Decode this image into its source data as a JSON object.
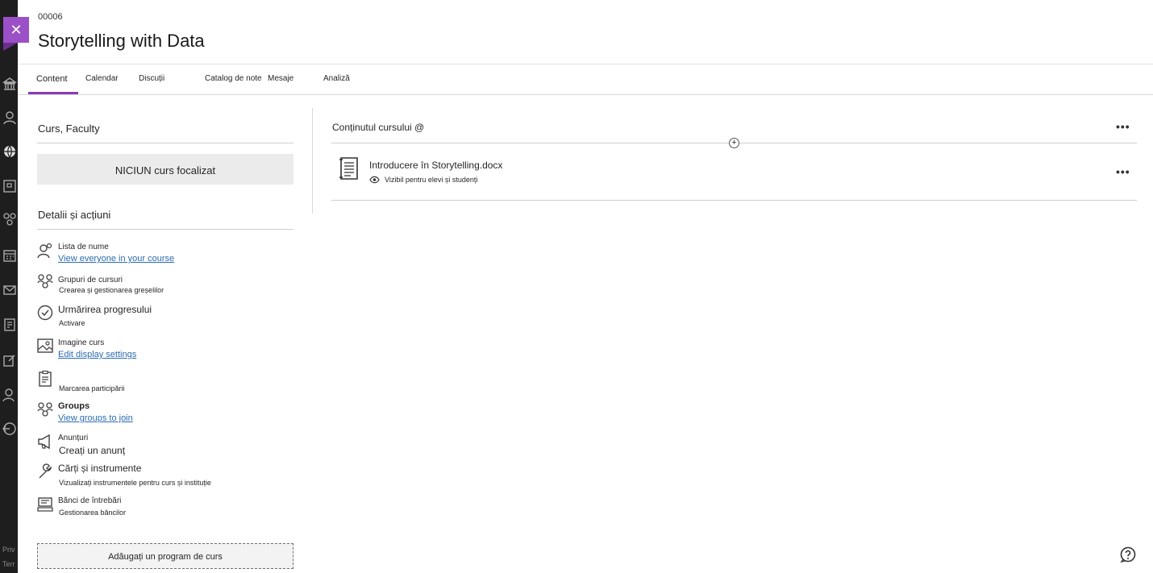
{
  "course": {
    "id": "00006",
    "title": "Storytelling with Data"
  },
  "tabs": [
    "Content",
    "Calendar",
    "Discuții",
    "Catalog de note",
    "Mesaje",
    "Analiză"
  ],
  "left": {
    "section1_title": "Curs, Faculty",
    "focus_label": "NICIUN curs focalizat",
    "section2_title": "Detalii și acțiuni",
    "details": [
      {
        "title": "Lista de nume",
        "sub": "View everyone in your course",
        "icon": "roster-icon"
      },
      {
        "title": "Grupuri de cursuri",
        "sub": "Crearea și gestionarea greșelilor",
        "icon": "groups-icon"
      },
      {
        "title": "Urmărirea progresului",
        "sub": "Activare",
        "icon": "check-circle-icon"
      },
      {
        "title": "Imagine curs",
        "sub": "Edit display settings",
        "icon": "image-icon"
      },
      {
        "title": "",
        "sub": "Marcarea participării",
        "icon": "clipboard-icon"
      },
      {
        "title": "Groups",
        "sub": "View groups to join",
        "icon": "groups-icon"
      },
      {
        "title": "Anunțuri",
        "sub": "Creați un anunț",
        "icon": "megaphone-icon"
      },
      {
        "title": "Cărți și instrumente",
        "sub": "Vizualizați instrumentele pentru curs și instituție",
        "icon": "wrench-icon"
      },
      {
        "title": "Bănci de întrebări",
        "sub": "Gestionarea băncilor",
        "icon": "question-bank-icon"
      }
    ],
    "add_syllabus": "Adăugați un program de curs"
  },
  "right": {
    "content_title": "Conținutul cursului @",
    "item": {
      "name": "Introducere în Storytelling.docx",
      "visibility": "Vizibil pentru elevi și studenți"
    },
    "more": "•••"
  },
  "rail_footer": [
    "Priv",
    "Terr"
  ],
  "colors": {
    "accent": "#8a3ab9",
    "close_bg": "#9c50c8",
    "rail_bg": "#1e1e1e",
    "link": "#2b6cb0"
  }
}
